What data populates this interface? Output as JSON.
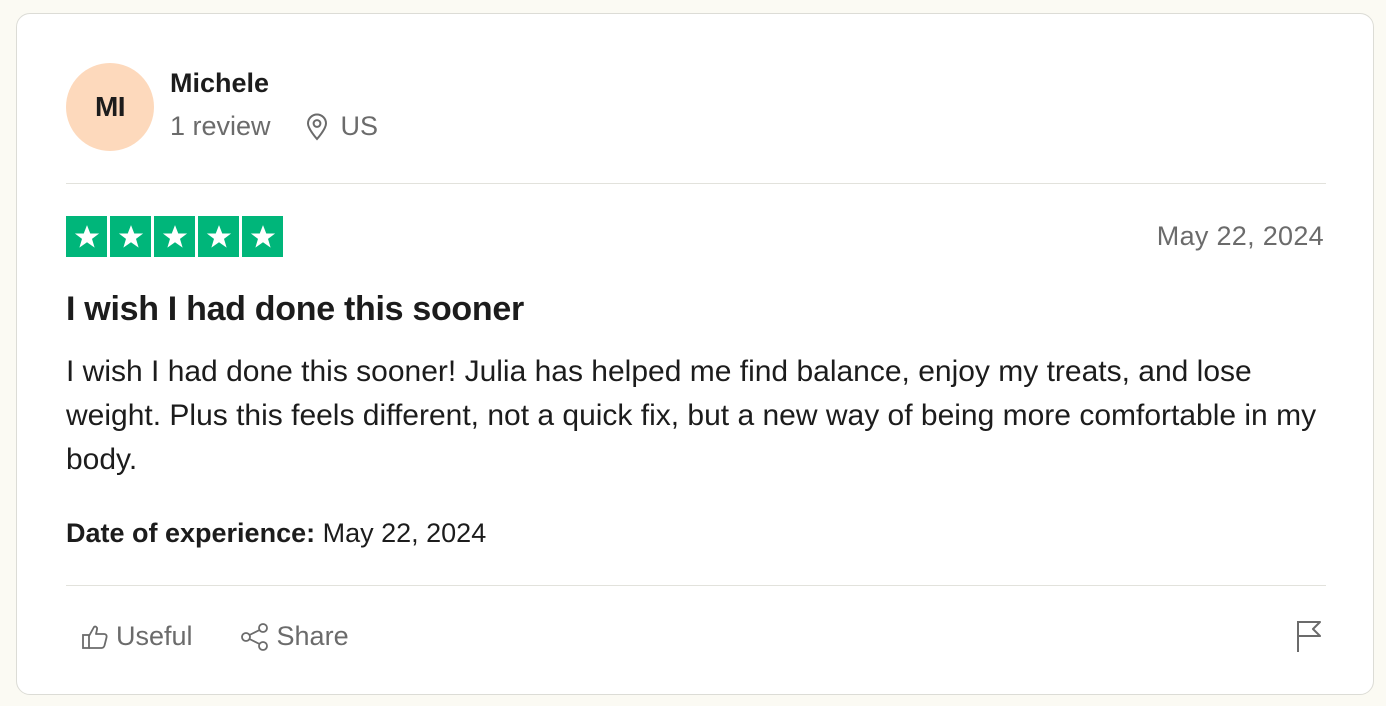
{
  "reviewer": {
    "initials": "MI",
    "name": "Michele",
    "review_count": "1 review",
    "location": "US",
    "avatar_color": "#fdd9bc"
  },
  "review": {
    "rating": 5,
    "rating_max": 5,
    "star_color": "#00b67a",
    "date": "May 22, 2024",
    "title": "I wish I had done this sooner",
    "body": "I wish I had done this sooner! Julia has helped me find balance, enjoy my treats, and lose weight. Plus this feels different, not a quick fix, but a new way of being more comfortable in my body.",
    "experience_label": "Date of experience:",
    "experience_date": "May 22, 2024"
  },
  "actions": {
    "useful_label": "Useful",
    "share_label": "Share",
    "useful_icon": "thumbs-up-icon",
    "share_icon": "share-icon",
    "report_icon": "flag-icon"
  }
}
